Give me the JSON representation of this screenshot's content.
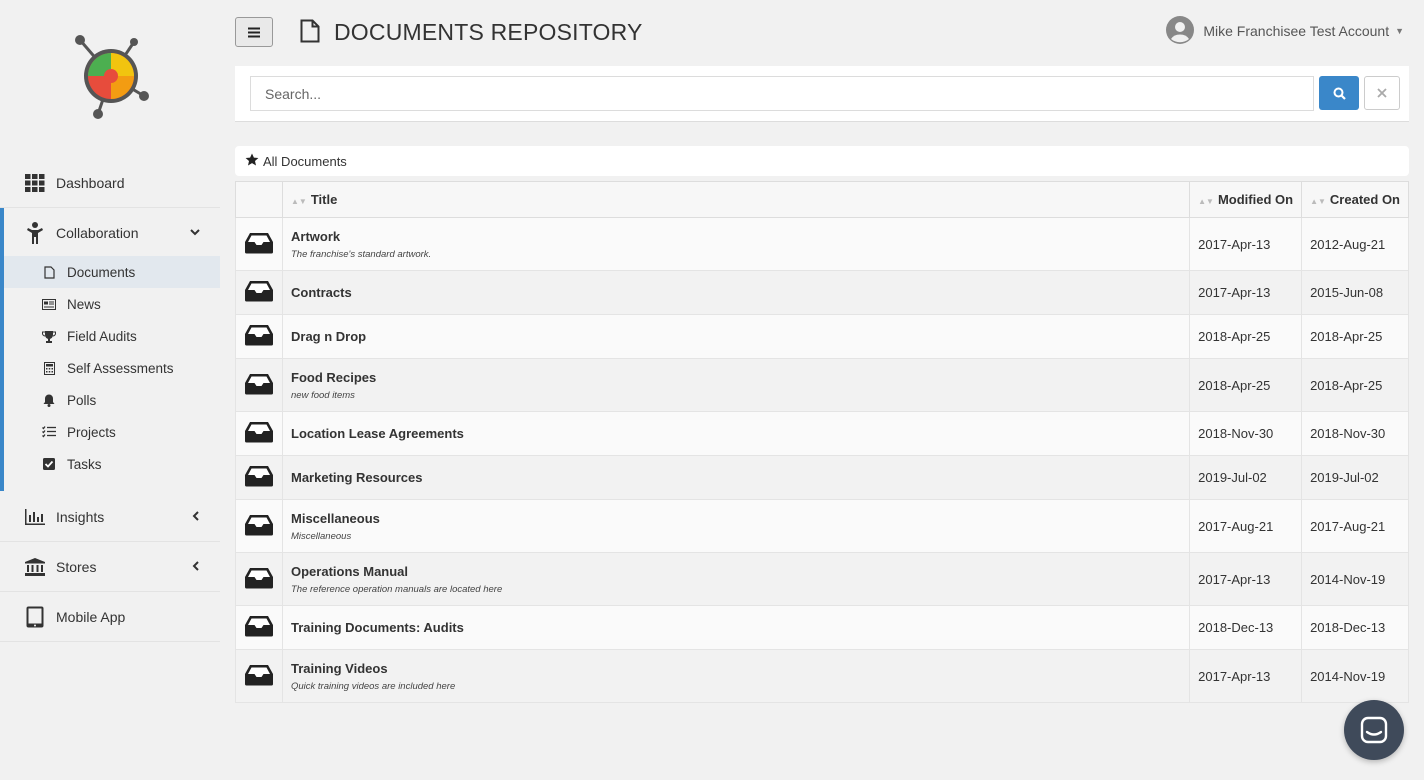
{
  "header": {
    "title": "DOCUMENTS REPOSITORY",
    "user_name": "Mike Franchisee Test Account"
  },
  "sidebar": {
    "items": [
      {
        "label": "Dashboard",
        "icon": "grid-icon"
      },
      {
        "label": "Collaboration",
        "icon": "person-icon"
      },
      {
        "label": "Insights",
        "icon": "bar-chart-icon"
      },
      {
        "label": "Stores",
        "icon": "bank-icon"
      },
      {
        "label": "Mobile App",
        "icon": "tablet-icon"
      }
    ],
    "collaboration_items": [
      {
        "label": "Documents",
        "icon": "file-icon"
      },
      {
        "label": "News",
        "icon": "newspaper-icon"
      },
      {
        "label": "Field Audits",
        "icon": "trophy-icon"
      },
      {
        "label": "Self Assessments",
        "icon": "calculator-icon"
      },
      {
        "label": "Polls",
        "icon": "bell-icon"
      },
      {
        "label": "Projects",
        "icon": "tasks-icon"
      },
      {
        "label": "Tasks",
        "icon": "checkbox-icon"
      }
    ]
  },
  "search": {
    "placeholder": "Search..."
  },
  "breadcrumb": {
    "label": "All Documents"
  },
  "table": {
    "headers": {
      "title": "Title",
      "modified": "Modified On",
      "created": "Created On"
    },
    "rows": [
      {
        "title": "Artwork",
        "desc": "The franchise's standard artwork.",
        "modified": "2017-Apr-13",
        "created": "2012-Aug-21"
      },
      {
        "title": "Contracts",
        "desc": "",
        "modified": "2017-Apr-13",
        "created": "2015-Jun-08"
      },
      {
        "title": "Drag n Drop",
        "desc": "",
        "modified": "2018-Apr-25",
        "created": "2018-Apr-25"
      },
      {
        "title": "Food Recipes",
        "desc": "new food items",
        "modified": "2018-Apr-25",
        "created": "2018-Apr-25"
      },
      {
        "title": "Location Lease Agreements",
        "desc": "",
        "modified": "2018-Nov-30",
        "created": "2018-Nov-30"
      },
      {
        "title": "Marketing Resources",
        "desc": "",
        "modified": "2019-Jul-02",
        "created": "2019-Jul-02"
      },
      {
        "title": "Miscellaneous",
        "desc": "Miscellaneous",
        "modified": "2017-Aug-21",
        "created": "2017-Aug-21"
      },
      {
        "title": "Operations Manual",
        "desc": "The reference operation manuals are located here",
        "modified": "2017-Apr-13",
        "created": "2014-Nov-19"
      },
      {
        "title": "Training Documents: Audits",
        "desc": "",
        "modified": "2018-Dec-13",
        "created": "2018-Dec-13"
      },
      {
        "title": "Training Videos",
        "desc": "Quick training videos are included here",
        "modified": "2017-Apr-13",
        "created": "2014-Nov-19"
      }
    ]
  },
  "colors": {
    "accent": "#3a87c9",
    "chat": "#3f4a5a"
  }
}
